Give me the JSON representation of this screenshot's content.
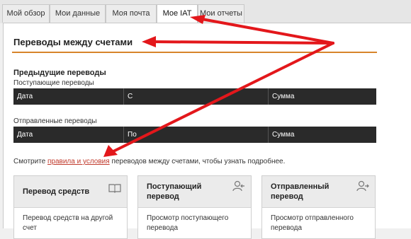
{
  "tabs": [
    {
      "label": "Мой обзор"
    },
    {
      "label": "Мои данные"
    },
    {
      "label": "Моя почта"
    },
    {
      "label": "Мое IAT"
    },
    {
      "label": "Мои отчеты"
    }
  ],
  "page": {
    "title": "Переводы между счетами",
    "previous_title": "Предыдущие переводы",
    "incoming_label": "Поступающие переводы",
    "incoming_headers": [
      "Дата",
      "С",
      "Сумма"
    ],
    "outgoing_label": "Отправленные переводы",
    "outgoing_headers": [
      "Дата",
      "По",
      "Сумма"
    ],
    "note_before": "Смотрите ",
    "note_link": "правила и условия",
    "note_after": " переводов между счетами, чтобы узнать подробнее."
  },
  "cards": [
    {
      "title": "Перевод средств",
      "body": "Перевод средств на другой счет",
      "icon": "book-icon"
    },
    {
      "title": "Поступающий перевод",
      "body": "Просмотр поступающего перевода",
      "icon": "user-incoming-icon"
    },
    {
      "title": "Отправленный перевод",
      "body": "Просмотр отправленного перевода",
      "icon": "user-outgoing-icon"
    }
  ],
  "colors": {
    "accent_orange": "#d7842b",
    "table_header": "#2a2a2a",
    "arrow_red": "#e3171b",
    "link_red": "#c0392b"
  }
}
